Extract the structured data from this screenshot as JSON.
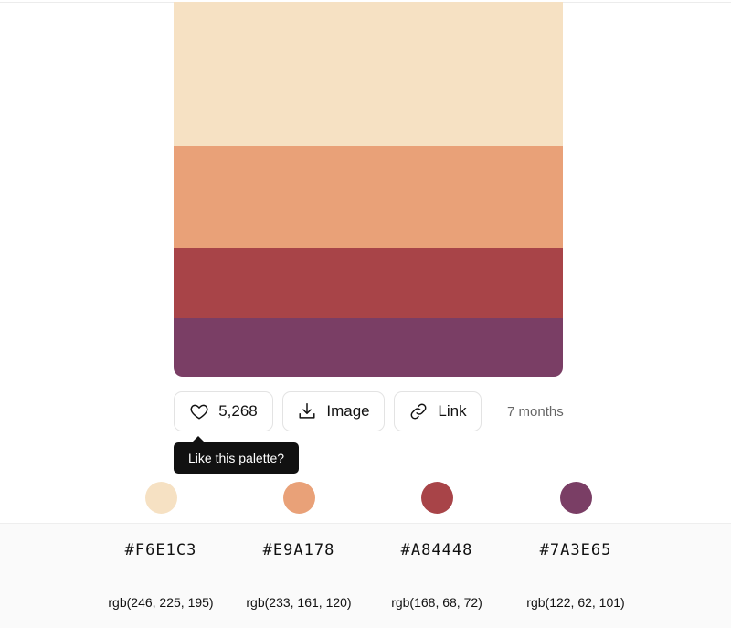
{
  "palette": {
    "colors": [
      "#F6E1C3",
      "#E9A178",
      "#A84448",
      "#7A3E65"
    ]
  },
  "actions": {
    "like_count": "5,268",
    "image_label": "Image",
    "link_label": "Link",
    "age": "7 months"
  },
  "tooltip": {
    "text": "Like this palette?"
  },
  "swatches": [
    {
      "hex": "#F6E1C3",
      "rgb": "rgb(246, 225, 195)"
    },
    {
      "hex": "#E9A178",
      "rgb": "rgb(233, 161, 120)"
    },
    {
      "hex": "#A84448",
      "rgb": "rgb(168, 68, 72)"
    },
    {
      "hex": "#7A3E65",
      "rgb": "rgb(122, 62, 101)"
    }
  ],
  "icons": {
    "like": "heart-icon",
    "image": "download-icon",
    "link": "link-icon"
  }
}
